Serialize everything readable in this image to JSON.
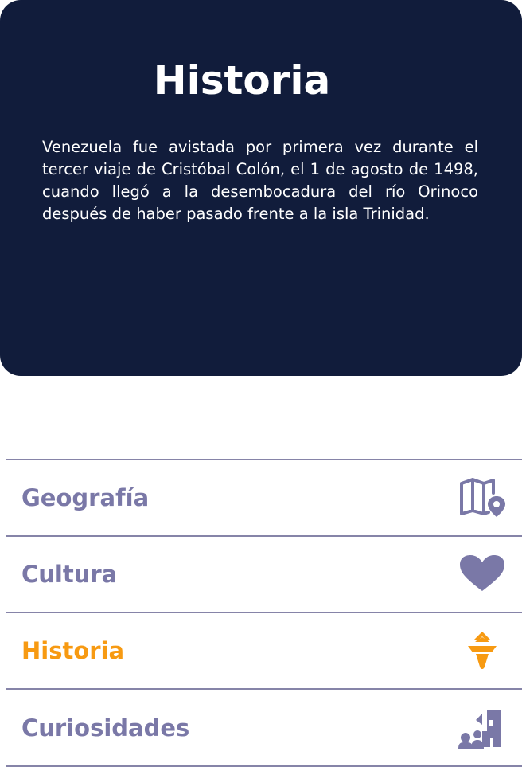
{
  "hero": {
    "title": "Historia",
    "text": "Venezuela fue avistada por primera vez durante el tercer viaje de Cristóbal Colón, el 1 de agosto de 1498, cuando llegó a la desembocadura del río Orinoco después de haber pasado frente a la isla Trinidad."
  },
  "menu": {
    "items": [
      {
        "label": "Geografía",
        "icon": "map-pin-icon",
        "active": false
      },
      {
        "label": "Cultura",
        "icon": "heart-icon",
        "active": false
      },
      {
        "label": "Historia",
        "icon": "torch-icon",
        "active": true
      },
      {
        "label": "Curiosidades",
        "icon": "people-ruins-icon",
        "active": false
      }
    ]
  },
  "colors": {
    "hero_background": "#111c3b",
    "menu_text": "#7a78a7",
    "active_text": "#f79a12",
    "divider": "#8684a8"
  }
}
